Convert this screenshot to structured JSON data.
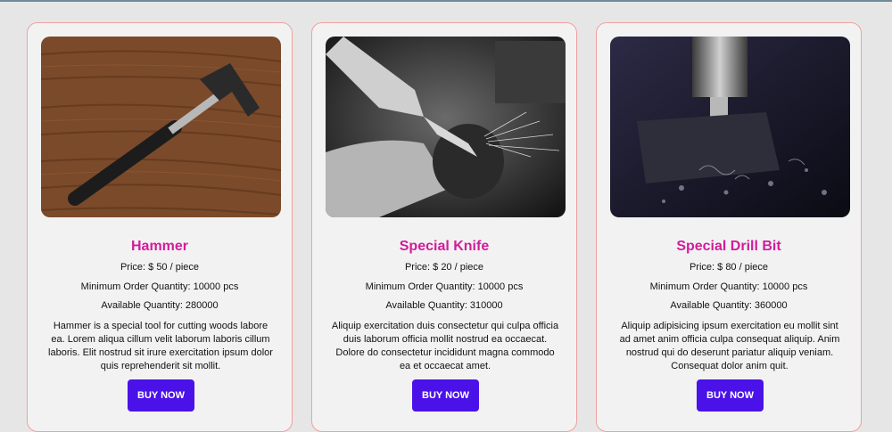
{
  "products": [
    {
      "name": "Hammer",
      "price": "Price: $ 50 / piece",
      "min_order": "Minimum Order Quantity: 10000 pcs",
      "available": "Available Quantity: 280000",
      "description": "Hammer is a special tool for cutting woods labore ea. Lorem aliqua cillum velit laborum laboris cillum laboris. Elit nostrud sit irure exercitation ipsum dolor quis reprehenderit sit mollit.",
      "button": "BUY NOW"
    },
    {
      "name": "Special Knife",
      "price": "Price: $ 20 / piece",
      "min_order": "Minimum Order Quantity: 10000 pcs",
      "available": "Available Quantity: 310000",
      "description": "Aliquip exercitation duis consectetur qui culpa officia duis laborum officia mollit nostrud ea occaecat. Dolore do consectetur incididunt magna commodo ea et occaecat amet.",
      "button": "BUY NOW"
    },
    {
      "name": "Special Drill Bit",
      "price": "Price: $ 80 / piece",
      "min_order": "Minimum Order Quantity: 10000 pcs",
      "available": "Available Quantity: 360000",
      "description": "Aliquip adipisicing ipsum exercitation eu mollit sint ad amet anim officia culpa consequat aliquip. Anim nostrud qui do deserunt pariatur aliquip veniam. Consequat dolor anim quit.",
      "button": "BUY NOW"
    }
  ],
  "colors": {
    "title": "#d11d9b",
    "button": "#4a12e8",
    "card_border": "#f0a0a0"
  }
}
